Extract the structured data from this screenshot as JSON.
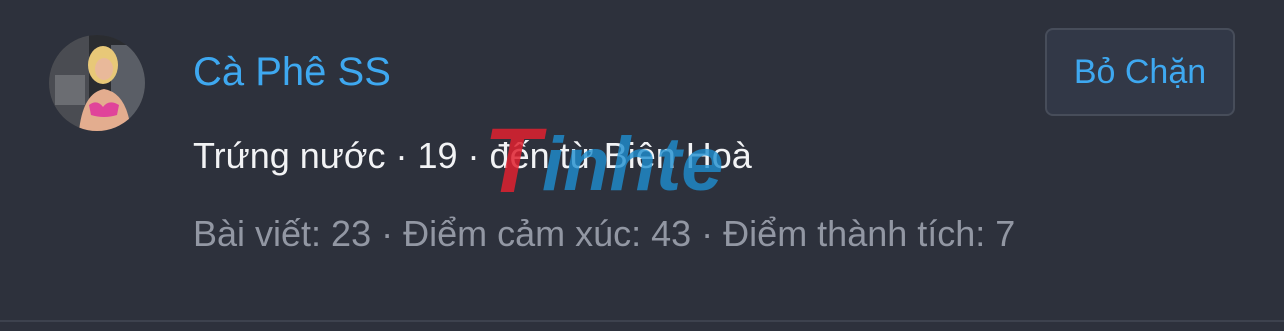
{
  "profile": {
    "username": "Cà Phê SS",
    "unblock_label": "Bỏ Chặn",
    "info": "Trứng nước · 19 · đến từ Biên Hoà",
    "stats": "Bài viết: 23 · Điểm cảm xúc: 43 · Điểm thành tích: 7"
  },
  "watermark": {
    "text": "Tinhte",
    "accent_color": "#e0212f",
    "secondary_color": "#1e8fd0"
  },
  "colors": {
    "background": "#2d313c",
    "link": "#3ea8f0",
    "primary_text": "#f2f3f5",
    "secondary_text": "#9297a3"
  }
}
